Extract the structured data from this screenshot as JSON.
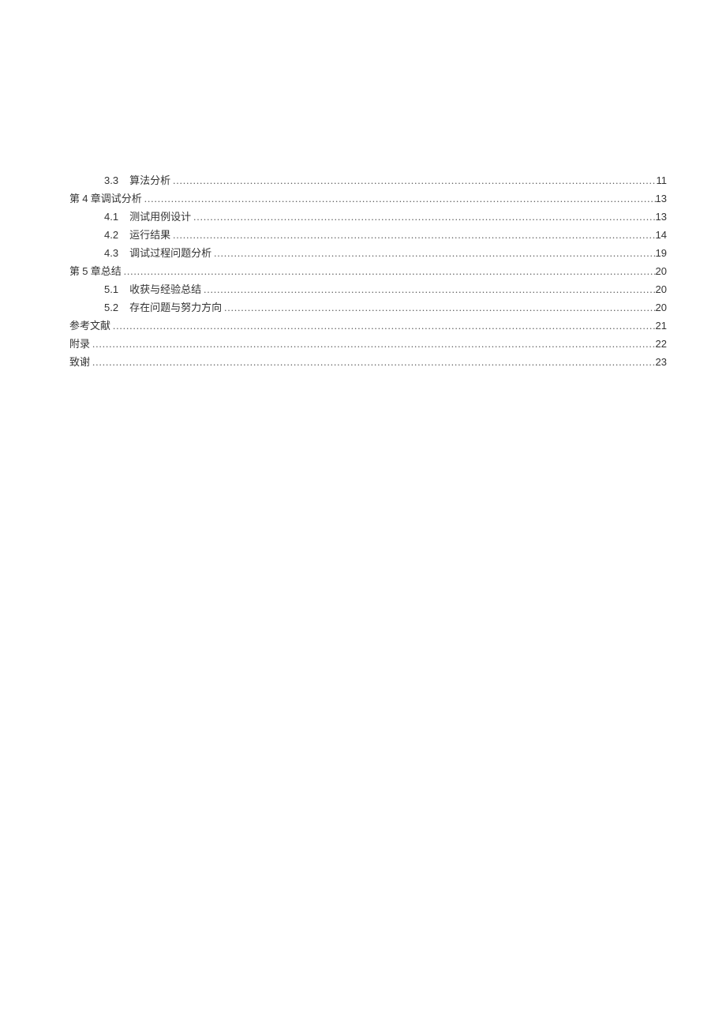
{
  "toc": [
    {
      "indent": 1,
      "num": "3.3",
      "title": "算法分析",
      "page": "11"
    },
    {
      "indent": 0,
      "num": "第 4 章",
      "title": "调试分析",
      "page": "13",
      "noGap": true
    },
    {
      "indent": 1,
      "num": "4.1",
      "title": "测试用例设计",
      "page": "13"
    },
    {
      "indent": 1,
      "num": "4.2",
      "title": "运行结果",
      "page": "14"
    },
    {
      "indent": 1,
      "num": "4.3",
      "title": "调试过程问题分析",
      "page": "19"
    },
    {
      "indent": 0,
      "num": "第 5 章",
      "title": "总结",
      "page": "20",
      "noGap": true
    },
    {
      "indent": 1,
      "num": "5.1",
      "title": "收获与经验总结",
      "page": "20"
    },
    {
      "indent": 1,
      "num": "5.2",
      "title": "存在问题与努力方向",
      "page": "20"
    },
    {
      "indent": 0,
      "num": "",
      "title": "参考文献",
      "page": "21"
    },
    {
      "indent": 0,
      "num": "",
      "title": "附录",
      "page": "22"
    },
    {
      "indent": 0,
      "num": "",
      "title": "致谢",
      "page": "23"
    }
  ]
}
